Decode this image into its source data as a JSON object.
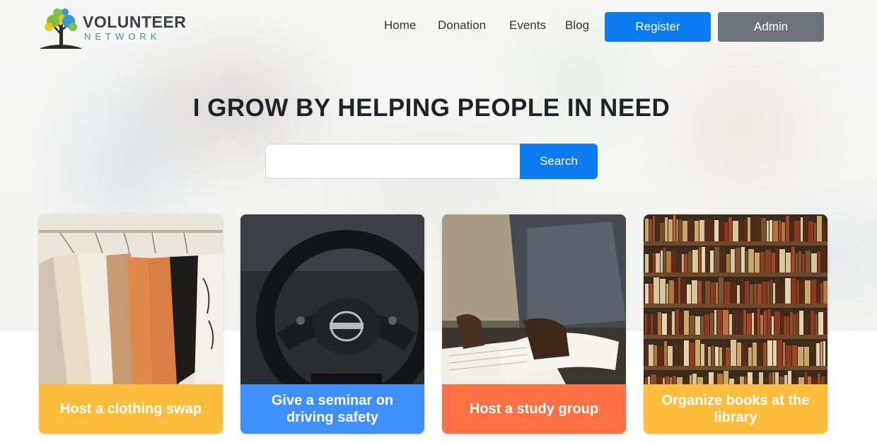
{
  "brand": {
    "name_top": "VOLUNTEER",
    "name_bottom": "NETWORK"
  },
  "nav": {
    "items": [
      "Home",
      "Donation",
      "Events",
      "Blog"
    ]
  },
  "header": {
    "register_label": "Register",
    "admin_label": "Admin"
  },
  "hero": {
    "title": "I GROW BY HELPING PEOPLE IN NEED"
  },
  "search": {
    "value": "",
    "placeholder": "",
    "button_label": "Search"
  },
  "events": [
    {
      "title": "Host a clothing swap",
      "image": "clothing-rack",
      "color": "#ffbd3e"
    },
    {
      "title": "Give a seminar on driving safety",
      "image": "steering-wheel",
      "color": "#3f90fc"
    },
    {
      "title": "Host a study group",
      "image": "study-books",
      "color": "#ff7044"
    },
    {
      "title": "Organize books at the library",
      "image": "library-shelves",
      "color": "#ffbd3e"
    }
  ],
  "colors": {
    "primary": "#0d7bf2",
    "secondary": "#6c737a"
  }
}
